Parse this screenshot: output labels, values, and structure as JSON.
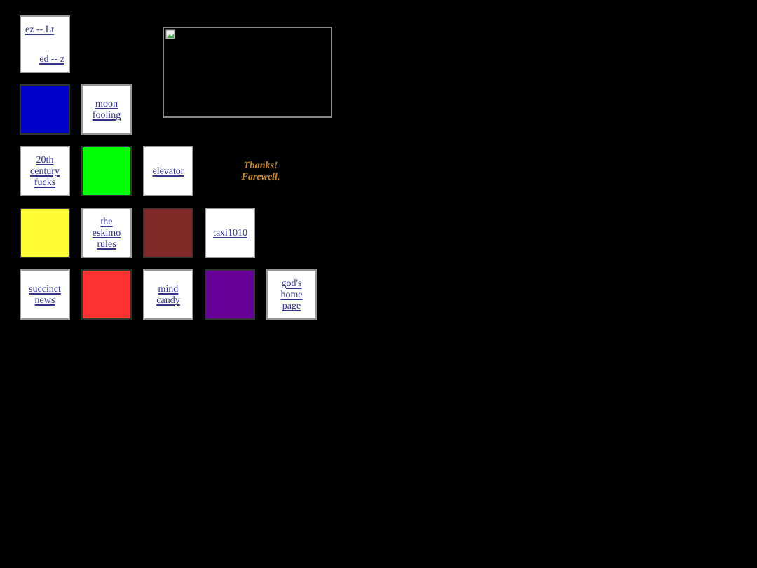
{
  "rows": [
    [
      {
        "kind": "links",
        "links": [
          "ez -- Lt",
          "ed -- z"
        ]
      },
      {
        "kind": "empty"
      },
      {
        "kind": "picture"
      }
    ],
    [
      {
        "kind": "color",
        "color": "#0000cc"
      },
      {
        "kind": "link",
        "text": "moon fooling"
      }
    ],
    [
      {
        "kind": "link",
        "text": "20th century fucks"
      },
      {
        "kind": "color",
        "color": "#00ff00"
      },
      {
        "kind": "link",
        "text": "elevator"
      },
      {
        "kind": "note",
        "text": "Thanks! Farewell."
      }
    ],
    [
      {
        "kind": "color",
        "color": "#ffff33"
      },
      {
        "kind": "link",
        "text": "the eskimo rules"
      },
      {
        "kind": "color",
        "color": "#802828"
      },
      {
        "kind": "link",
        "text": "taxi1010"
      }
    ],
    [
      {
        "kind": "link",
        "text": "succinct news"
      },
      {
        "kind": "color",
        "color": "#ff3333"
      },
      {
        "kind": "link",
        "text": "mind candy"
      },
      {
        "kind": "color",
        "color": "#660099"
      },
      {
        "kind": "link",
        "text": "god's home page"
      }
    ]
  ]
}
